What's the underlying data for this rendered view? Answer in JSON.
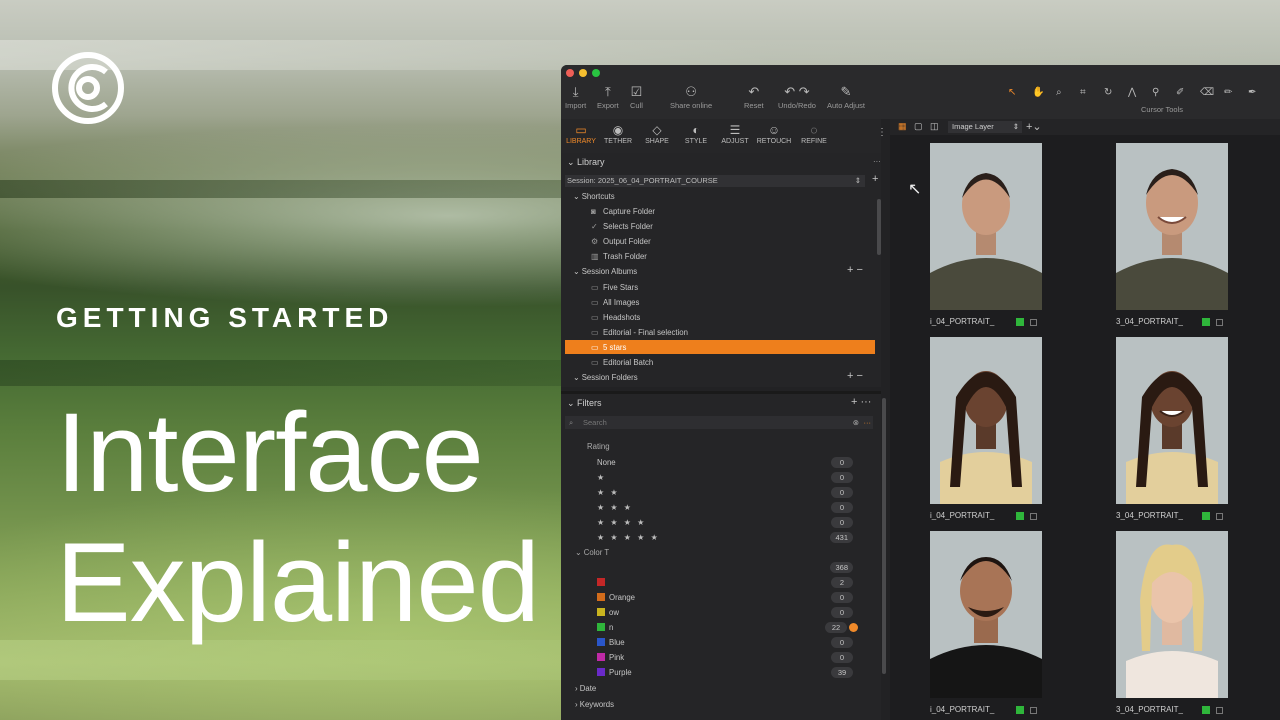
{
  "overlay": {
    "kicker": "GETTING STARTED",
    "headline_line1": "Interface",
    "headline_line2": "Explained"
  },
  "toolbar": {
    "import": "Import",
    "export": "Export",
    "cull": "Cull",
    "share_online": "Share online",
    "reset": "Reset",
    "undo_redo": "Undo/Redo",
    "auto_adjust": "Auto Adjust",
    "cursor_tools": "Cursor Tools"
  },
  "tabs": [
    "LIBRARY",
    "TETHER",
    "SHAPE",
    "STYLE",
    "ADJUST",
    "RETOUCH",
    "REFINE"
  ],
  "library": {
    "title": "Library",
    "session": "Session: 2025_06_04_PORTRAIT_COURSE",
    "shortcuts_title": "Shortcuts",
    "shortcuts": [
      "Capture Folder",
      "Selects Folder",
      "Output Folder",
      "Trash Folder"
    ],
    "albums_title": "Session Albums",
    "albums": [
      "Five Stars",
      "All Images",
      "Headshots",
      "Editorial - Final selection",
      "5 stars",
      "Editorial Batch"
    ],
    "folders_title": "Session Folders"
  },
  "filters": {
    "title": "Filters",
    "search_placeholder": "Search",
    "rating_title": "Rating",
    "ratings": [
      {
        "label": "None",
        "count": "0"
      },
      {
        "label": "★",
        "count": "0"
      },
      {
        "label": "★ ★",
        "count": "0"
      },
      {
        "label": "★ ★ ★",
        "count": "0"
      },
      {
        "label": "★ ★ ★ ★",
        "count": "0"
      },
      {
        "label": "★ ★ ★ ★ ★",
        "count": "431"
      }
    ],
    "color_title": "Color T",
    "colors": [
      {
        "label": "",
        "count": "368",
        "color": ""
      },
      {
        "label": "",
        "count": "2",
        "color": "#c42727"
      },
      {
        "label": "Orange",
        "count": "0",
        "color": "#d36c1b"
      },
      {
        "label": "ow",
        "count": "0",
        "color": "#c9b41f"
      },
      {
        "label": "n",
        "count": "22",
        "color": "#2fb63b"
      },
      {
        "label": "Blue",
        "count": "0",
        "color": "#2a56c9"
      },
      {
        "label": "Pink",
        "count": "0",
        "color": "#c02aa7"
      },
      {
        "label": "Purple",
        "count": "39",
        "color": "#6a2ac9"
      }
    ],
    "date_title": "Date",
    "keywords_title": "Keywords"
  },
  "viewer": {
    "layer": "Image Layer",
    "thumbs": [
      {
        "name": "_04_PORTRAIT_",
        "prefix": "",
        "color_tag": "green"
      },
      {
        "name": "_04_PORTRAIT_",
        "prefix": "",
        "color_tag": "green"
      },
      {
        "name": "_04_PORTRAIT_",
        "prefix": "",
        "color_tag": "green"
      },
      {
        "name": "_04_PORTRAIT_",
        "prefix": "",
        "color_tag": "green"
      },
      {
        "name": "_04_PORTRAIT_",
        "prefix": "",
        "color_tag": "green"
      },
      {
        "name": "_04_PORTRAIT_",
        "prefix": "",
        "color_tag": "green"
      }
    ],
    "thumb_labels": [
      "i_04_PORTRAIT_",
      "3_04_PORTRAIT_",
      "i_04_PORTRAIT_",
      "3_04_PORTRAIT_",
      "i_04_PORTRAIT_",
      "3_04_PORTRAIT_"
    ]
  },
  "colors": {
    "accent": "#ee7f1c",
    "green_tag": "#2fb63b",
    "panel": "#252527"
  }
}
